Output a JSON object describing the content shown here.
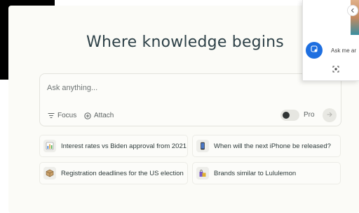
{
  "page": {
    "title": "Where knowledge begins"
  },
  "search": {
    "placeholder": "Ask anything...",
    "focus_label": "Focus",
    "attach_label": "Attach",
    "pro_label": "Pro",
    "pro_enabled": false
  },
  "suggestions": [
    {
      "icon": "chart-icon",
      "text": "Interest rates vs Biden approval from 2021"
    },
    {
      "icon": "phone-icon",
      "text": "When will the next iPhone be released?"
    },
    {
      "icon": "box-icon",
      "text": "Registration deadlines for the US election"
    },
    {
      "icon": "shopping-bag-icon",
      "text": "Brands similar to Lululemon"
    }
  ],
  "overlay": {
    "ask_placeholder": "Ask me ar",
    "icons": [
      "chevron-left-icon",
      "assistant-icon",
      "screenshot-icon"
    ]
  },
  "colors": {
    "background": "#fbfbf7",
    "accent": "#1e6fe0",
    "title": "#2e4148"
  }
}
